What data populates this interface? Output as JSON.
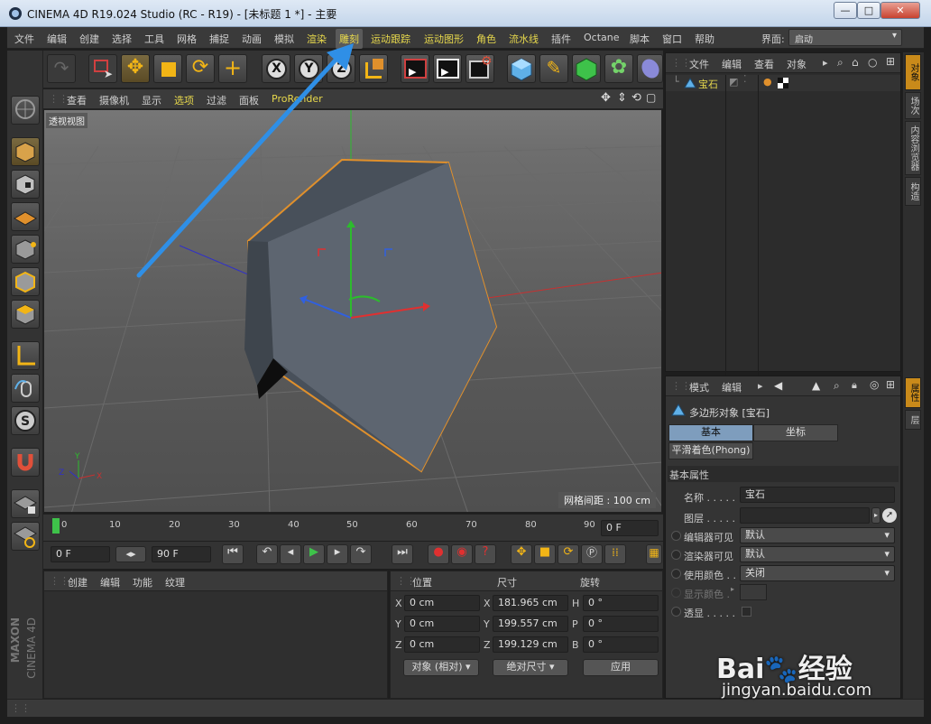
{
  "window": {
    "title": "CINEMA 4D R19.024 Studio (RC - R19) - [未标题 1 *] - 主要",
    "min": "—",
    "max": "□",
    "close": "✕"
  },
  "menu": {
    "items": [
      "文件",
      "编辑",
      "创建",
      "选择",
      "工具",
      "网格",
      "捕捉",
      "动画",
      "模拟",
      "渲染",
      "雕刻",
      "运动跟踪",
      "运动图形",
      "角色",
      "流水线",
      "插件",
      "Octane",
      "脚本",
      "窗口",
      "帮助"
    ],
    "layout_label": "界面:",
    "layout_value": "启动"
  },
  "viewport": {
    "menu": [
      "查看",
      "摄像机",
      "显示",
      "选项",
      "过滤",
      "面板",
      "ProRender"
    ],
    "label": "透视视图",
    "grid_spacing": "网格间距 : 100 cm"
  },
  "timeline": {
    "ticks": [
      "0",
      "10",
      "20",
      "30",
      "40",
      "50",
      "60",
      "70",
      "80",
      "90"
    ],
    "frame_field": "0 F"
  },
  "transport": {
    "start": "0 F",
    "end": "90 F"
  },
  "material": {
    "menu": [
      "创建",
      "编辑",
      "功能",
      "纹理"
    ]
  },
  "coords": {
    "headers": [
      "位置",
      "尺寸",
      "旋转"
    ],
    "rows": [
      {
        "axis": "X",
        "pos": "0 cm",
        "size_axis": "X",
        "size": "181.965 cm",
        "rot_axis": "H",
        "rot": "0 °"
      },
      {
        "axis": "Y",
        "pos": "0 cm",
        "size_axis": "Y",
        "size": "199.557 cm",
        "rot_axis": "P",
        "rot": "0 °"
      },
      {
        "axis": "Z",
        "pos": "0 cm",
        "size_axis": "Z",
        "size": "199.129 cm",
        "rot_axis": "B",
        "rot": "0 °"
      }
    ],
    "mode": "对象 (相对)",
    "size_mode": "绝对尺寸",
    "apply": "应用"
  },
  "objects": {
    "menu": [
      "文件",
      "编辑",
      "查看",
      "对象"
    ],
    "item": "宝石"
  },
  "attributes": {
    "menu": [
      "模式",
      "编辑"
    ],
    "title": "多边形对象 [宝石]",
    "tabs": [
      "基本",
      "坐标"
    ],
    "phong": "平滑着色(Phong)",
    "section": "基本属性",
    "name_label": "名称 . . . . .",
    "name": "宝石",
    "layer_label": "图层 . . . . .",
    "editor_label": "编辑器可见",
    "editor": "默认",
    "render_label": "渲染器可见",
    "render": "默认",
    "color_label": "使用颜色 . .",
    "color": "关闭",
    "display_color": "显示颜色 .",
    "xray": "透显 . . . . ."
  },
  "right_tabs_top": [
    "对象",
    "场次",
    "内容浏览器",
    "构造"
  ],
  "right_tabs_bottom": [
    "属性",
    "层"
  ],
  "brand": {
    "logo": "MAXON",
    "product": "CINEMA 4D"
  },
  "watermark": {
    "logo": "Bai🐾经验",
    "url": "jingyan.baidu.com"
  },
  "colors": {
    "accent": "#c98a1a",
    "highlight_menu": "#e7d84c",
    "arrow": "#2f8fe6"
  }
}
